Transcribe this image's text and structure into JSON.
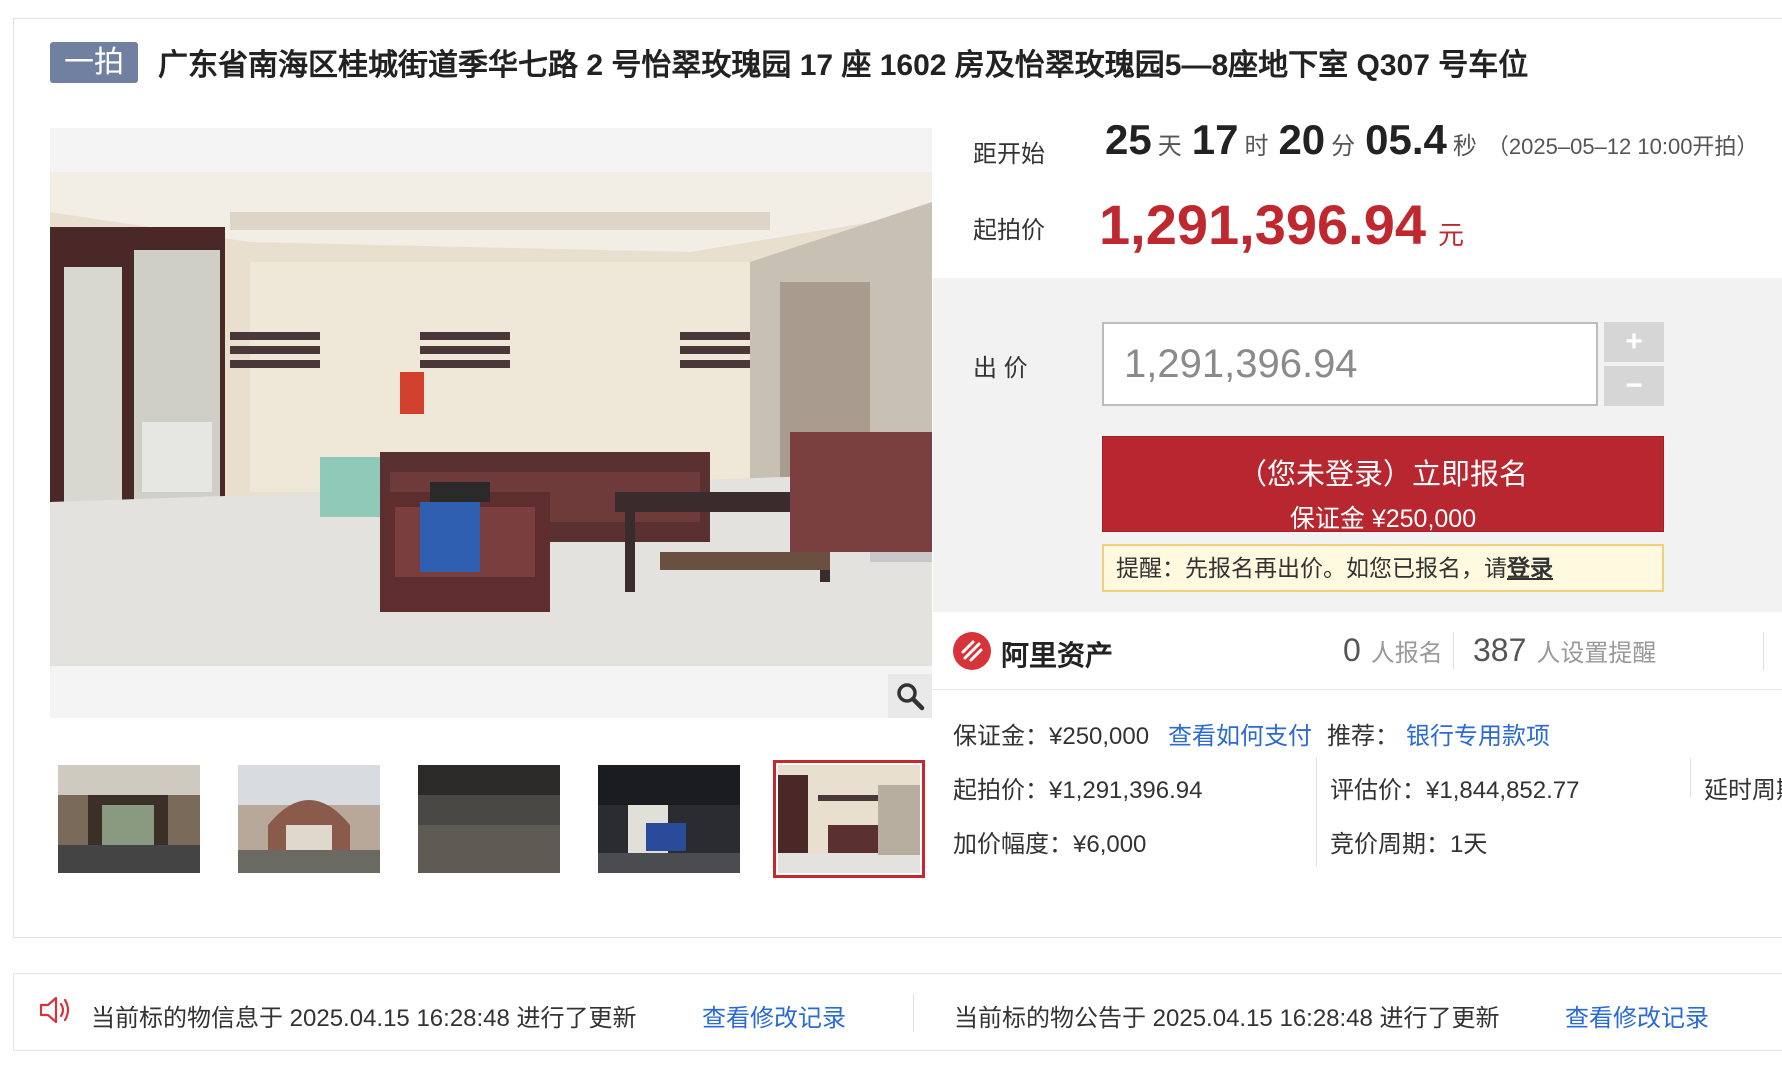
{
  "header": {
    "round_badge": "一拍",
    "title": "广东省南海区桂城街道季华七路 2 号怡翠玫瑰园 17 座 1602 房及怡翠玫瑰园5—8座地下室 Q307 号车位"
  },
  "countdown": {
    "label": "距开始",
    "days": "25",
    "days_unit": "天",
    "hours": "17",
    "hours_unit": "时",
    "minutes": "20",
    "minutes_unit": "分",
    "seconds": "05.4",
    "seconds_unit": "秒",
    "start_note": "（2025–05–12 10:00开拍）"
  },
  "start_price": {
    "label": "起拍价",
    "value": "1,291,396.94",
    "unit": "元"
  },
  "bid": {
    "label": "出 价",
    "input_value": "1,291,396.94",
    "plus": "+",
    "minus": "−",
    "signup_main": "（您未登录）立即报名",
    "signup_sub": "保证金 ¥250,000",
    "reminder_text": "提醒：先报名再出价。如您已报名，请",
    "reminder_link": "登录"
  },
  "platform": {
    "name": "阿里资产",
    "signups_count": "0",
    "signups_label": "人报名",
    "reminders_count": "387",
    "reminders_label": "人设置提醒"
  },
  "details": {
    "deposit": "保证金：¥250,000",
    "how_to_pay": "查看如何支付",
    "recommend_label": "推荐：",
    "recommend_link": "银行专用款项",
    "start_price": "起拍价：¥1,291,396.94",
    "appraisal": "评估价：¥1,844,852.77",
    "delay_cycle": "延时周期",
    "increment": "加价幅度：¥6,000",
    "bid_cycle": "竞价周期：1天"
  },
  "updates": {
    "item_update": "当前标的物信息于 2025.04.15 16:28:48 进行了更新",
    "item_link": "查看修改记录",
    "notice_update": "当前标的物公告于 2025.04.15 16:28:48 进行了更新",
    "notice_link": "查看修改记录"
  },
  "icons": {
    "zoom": "magnifier-icon",
    "speaker": "speaker-icon",
    "logo": "ali-asset-logo"
  },
  "colors": {
    "accent_red": "#c0282f",
    "button_red": "#b8272f",
    "link_blue": "#2a6ad6",
    "badge_slate": "#7080a0"
  }
}
